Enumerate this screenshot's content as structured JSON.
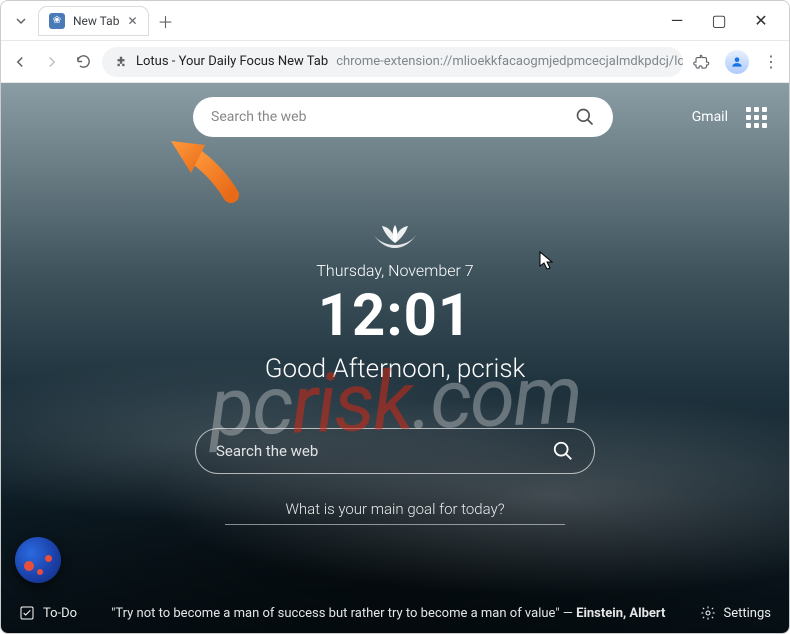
{
  "chrome": {
    "tab_title": "New Tab",
    "omnibox_title": "Lotus - Your Daily Focus New Tab",
    "omnibox_url": "chrome-extension://mlioekkfacaogmjedpmcecjalmdkpdcj/lotus.html"
  },
  "top": {
    "search_placeholder": "Search the web",
    "gmail": "Gmail"
  },
  "center": {
    "date": "Thursday, November 7",
    "time": "12:01",
    "greeting": "Good Afternoon, pcrisk",
    "search_placeholder": "Search the web",
    "goal_placeholder": "What is your main goal for today?"
  },
  "bottom": {
    "todo": "To-Do",
    "quote": "\"Try not to become a man of success but rather try to become a man of value\"",
    "quote_sep": " — ",
    "author": "Einstein, Albert",
    "settings": "Settings"
  },
  "watermark": {
    "p1": "pc",
    "p2": "risk",
    "p3": ".com"
  }
}
